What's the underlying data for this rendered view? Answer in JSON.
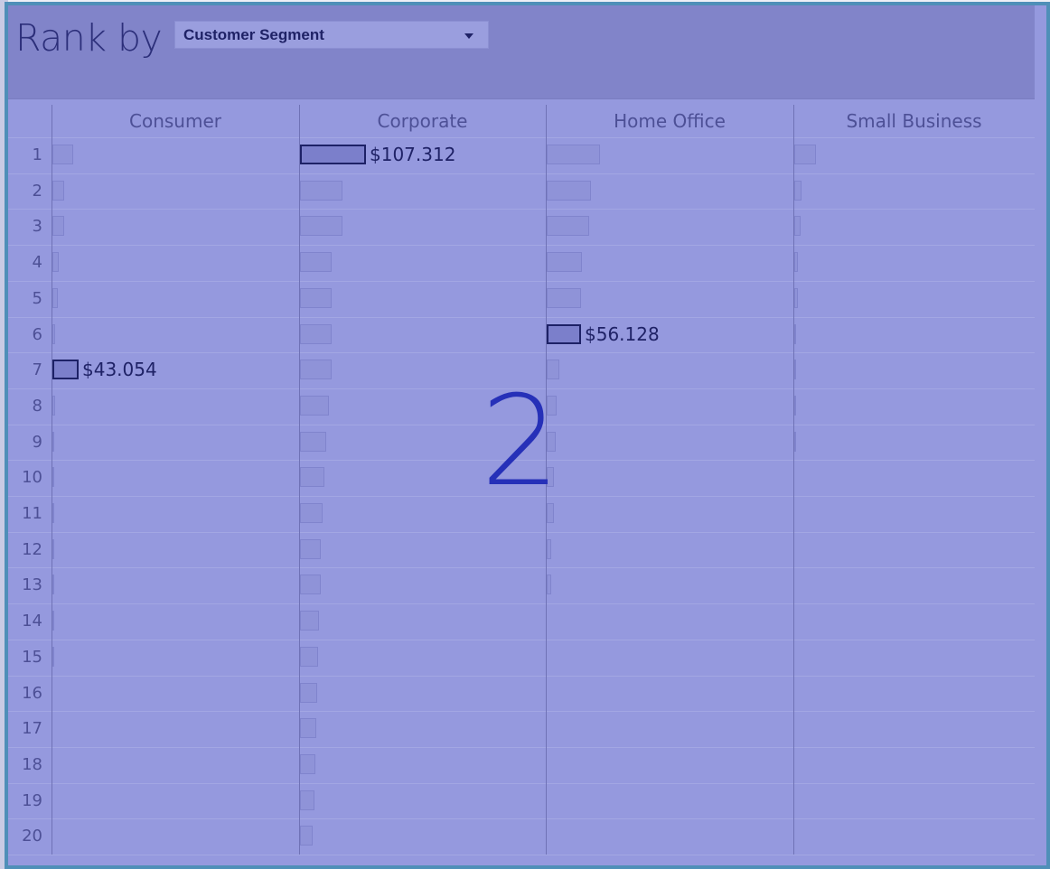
{
  "header": {
    "title": "Rank by",
    "selector_value": "Customer Segment"
  },
  "overlay_label": "2",
  "colors": {
    "bar": "#8f93d8",
    "selected_bar": "#7b7fcb",
    "selected_outline": "#1d2166",
    "overlay_text": "#2630b8"
  },
  "chart_data": {
    "type": "bar",
    "title": "",
    "ranks": [
      "1",
      "2",
      "3",
      "4",
      "5",
      "6",
      "7",
      "8",
      "9",
      "10",
      "11",
      "12",
      "13",
      "14",
      "15",
      "16",
      "17",
      "18",
      "19",
      "20"
    ],
    "xlim": [
      0,
      107.312
    ],
    "series": [
      {
        "name": "Consumer",
        "values": [
          33.5,
          19.8,
          19.5,
          9.6,
          8.5,
          5.1,
          43.054,
          4.4,
          3.3,
          3.0,
          2.6,
          1.2,
          1.0,
          0.7,
          0.6
        ],
        "selected_rank": 7,
        "selected_label": "$43.054"
      },
      {
        "name": "Corporate",
        "values": [
          107.312,
          69.5,
          69.0,
          51.5,
          51.0,
          51.0,
          51.0,
          46.5,
          43.0,
          40.0,
          37.0,
          34.5,
          34.0,
          30.5,
          30.0,
          27.5,
          27.0,
          24.5,
          24.0,
          21.0
        ],
        "selected_rank": 1,
        "selected_label": "$107.312"
      },
      {
        "name": "Home Office",
        "values": [
          86.0,
          71.5,
          69.5,
          57.5,
          56.5,
          56.128,
          21.0,
          16.0,
          14.5,
          12.0,
          11.5,
          7.5,
          7.0
        ],
        "selected_rank": 6,
        "selected_label": "$56.128"
      },
      {
        "name": "Small Business",
        "values": [
          35.2,
          12.2,
          10.4,
          6.0,
          5.6,
          3.2,
          3.0,
          1.2,
          1.0
        ],
        "selected_rank": null,
        "selected_label": ""
      }
    ]
  }
}
